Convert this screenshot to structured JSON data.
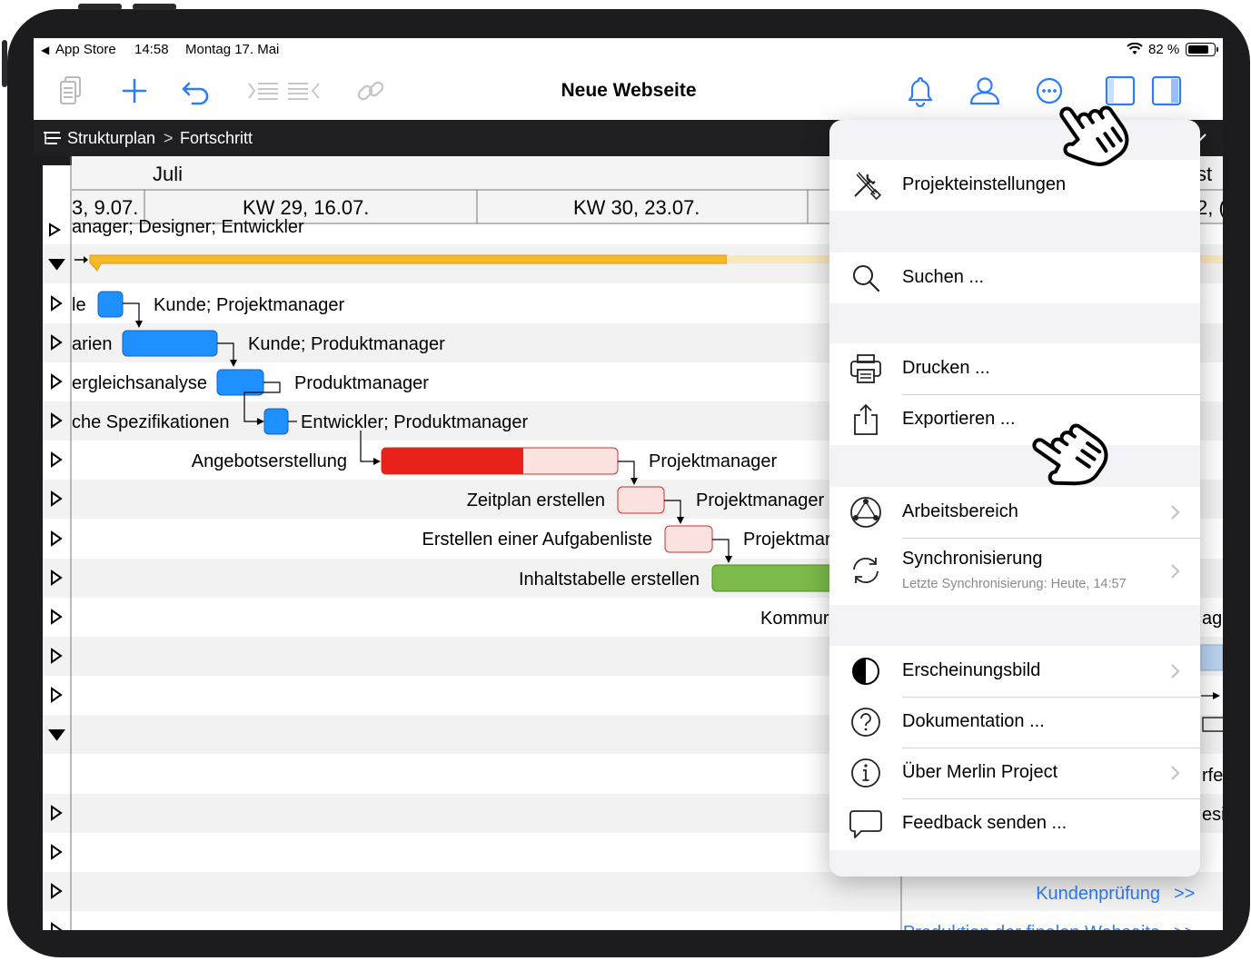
{
  "status": {
    "back_app": "App Store",
    "time": "14:58",
    "date": "Montag 17. Mai",
    "battery": "82 %",
    "battery_level": 0.82
  },
  "toolbar": {
    "title": "Neue Webseite",
    "icons": [
      "documents-icon",
      "plus-icon",
      "undo-icon",
      "outdent-icon",
      "indent-icon",
      "link-icon",
      "bell-icon",
      "person-icon",
      "more-icon",
      "inspector-left-icon",
      "inspector-right-icon"
    ]
  },
  "breadcrumb": {
    "root": "Strukturplan",
    "separator": ">",
    "current": "Fortschritt"
  },
  "timeline": {
    "month": "Juli",
    "month_right": "st",
    "weeks": [
      "3, 9.07.",
      "KW 29, 16.07.",
      "KW 30, 23.07.",
      "2, ("
    ]
  },
  "gantt": {
    "top_label": "anager; Designer; Entwickler",
    "rows": [
      {
        "name": "le",
        "resources": "Kunde; Projektmanager"
      },
      {
        "name": "arien",
        "resources": "Kunde; Produktmanager"
      },
      {
        "name": "ergleichsanalyse",
        "resources": "Produktmanager"
      },
      {
        "name": "che Spezifikationen",
        "resources": "Entwickler; Produktmanager"
      },
      {
        "name": "Angebotserstellung",
        "resources": "Projektmanager"
      },
      {
        "name": "Zeitplan erstellen",
        "resources": "Projektmanager"
      },
      {
        "name": "Erstellen einer Aufgabenliste",
        "resources": "Projektmar"
      },
      {
        "name": "Inhaltstabelle erstellen",
        "resources": ""
      },
      {
        "name": "Kommur",
        "resources": ""
      }
    ],
    "right_clipped": [
      "age",
      "rfe",
      "esi"
    ],
    "bottom_links": [
      "Kundenprüfung",
      "Produktion der finalen Webseite"
    ],
    "link_arrow": ">>",
    "colors": {
      "summary": "#f7b928",
      "blue": "#1e90ff",
      "red": "#e8221b",
      "green": "#7cba4a",
      "pink": "#fbe1df"
    }
  },
  "menu": {
    "items": [
      {
        "label": "Projekteinstellungen",
        "icon": "tools-icon"
      },
      {
        "label": "Suchen ...",
        "icon": "magnifier-icon"
      },
      {
        "label": "Drucken ...",
        "icon": "printer-icon"
      },
      {
        "label": "Exportieren ...",
        "icon": "share-icon"
      },
      {
        "label": "Arbeitsbereich",
        "icon": "workspace-icon"
      },
      {
        "label": "Synchronisierung",
        "icon": "sync-icon",
        "subtitle": "Letzte Synchronisierung: Heute, 14:57"
      },
      {
        "label": "Erscheinungsbild",
        "icon": "contrast-icon"
      },
      {
        "label": "Dokumentation ...",
        "icon": "question-icon"
      },
      {
        "label": "Über Merlin Project",
        "icon": "info-icon"
      },
      {
        "label": "Feedback senden ...",
        "icon": "speech-bubble-icon"
      }
    ]
  }
}
